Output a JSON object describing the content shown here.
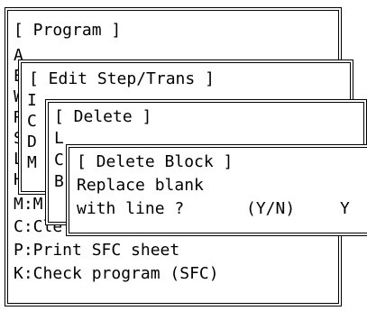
{
  "program": {
    "title": "[ Program ]",
    "letters": [
      "A",
      "E",
      "W",
      "R",
      "S",
      "L",
      "H"
    ],
    "items": [
      {
        "key": "M",
        "label": "M:M"
      },
      {
        "key": "C",
        "label": "C:Cle"
      },
      {
        "key": "P",
        "label": "P:Print SFC sheet"
      },
      {
        "key": "K",
        "label": "K:Check program (SFC)"
      }
    ]
  },
  "edit_step": {
    "title": "[ Edit Step/Trans ]",
    "letters": [
      "I",
      "C",
      "D",
      "M"
    ]
  },
  "delete": {
    "title": "[ Delete ]",
    "letters": [
      "L",
      "C",
      "B"
    ]
  },
  "delete_block": {
    "title": "[ Delete Block ]",
    "line1": "Replace blank",
    "line2_prompt": "with line ?",
    "line2_choices": "(Y/N)",
    "answer": "Y"
  }
}
